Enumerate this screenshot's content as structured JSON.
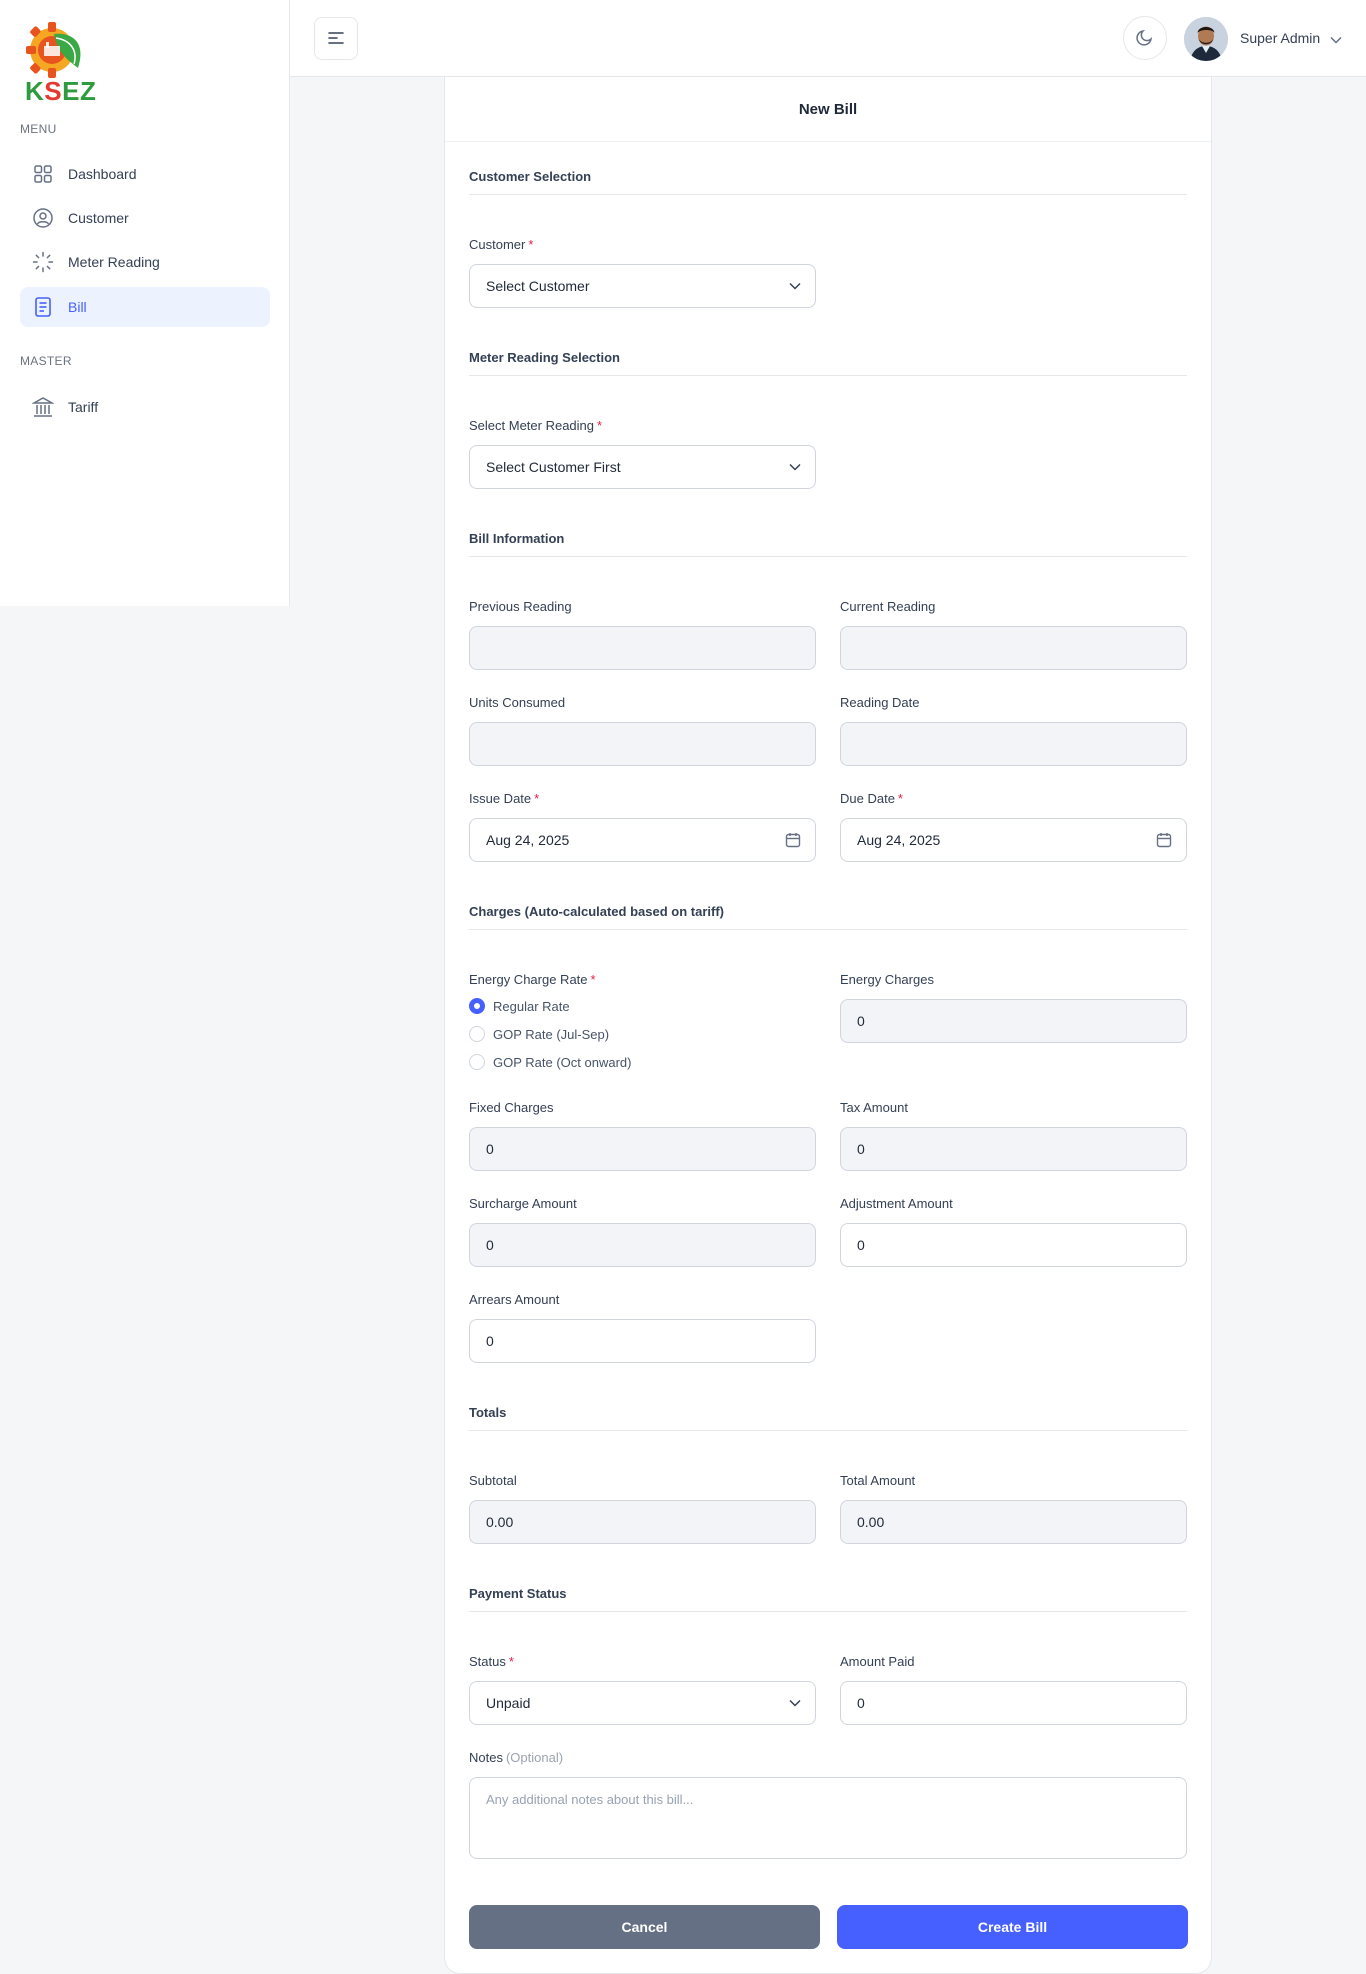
{
  "app": {
    "logo_text_k": "K",
    "logo_text_s": "S",
    "logo_text_rest": "EZ"
  },
  "sidebar": {
    "menu_heading": "MENU",
    "master_heading": "MASTER",
    "items": [
      {
        "label": "Dashboard",
        "icon": "grid-icon"
      },
      {
        "label": "Customer",
        "icon": "user-circle-icon"
      },
      {
        "label": "Meter Reading",
        "icon": "loader-icon"
      },
      {
        "label": "Bill",
        "icon": "document-icon",
        "active": true
      },
      {
        "label": "Tariff",
        "icon": "bank-icon"
      }
    ]
  },
  "header": {
    "user_name": "Super Admin"
  },
  "form": {
    "title": "New Bill",
    "sections": {
      "customer": "Customer Selection",
      "meter": "Meter Reading Selection",
      "bill_info": "Bill Information",
      "charges": "Charges (Auto-calculated based on tariff)",
      "totals": "Totals",
      "payment": "Payment Status"
    },
    "customer_label": "Customer",
    "customer_value": "Select Customer",
    "meter_label": "Select Meter Reading",
    "meter_value": "Select Customer First",
    "previous_reading_label": "Previous Reading",
    "current_reading_label": "Current Reading",
    "units_consumed_label": "Units Consumed",
    "reading_date_label": "Reading Date",
    "issue_date_label": "Issue Date",
    "issue_date_value": "Aug 24, 2025",
    "due_date_label": "Due Date",
    "due_date_value": "Aug 24, 2025",
    "energy_rate_label": "Energy Charge Rate",
    "rate_options": [
      "Regular Rate",
      "GOP Rate (Jul-Sep)",
      "GOP Rate (Oct onward)"
    ],
    "selected_rate": "Regular Rate",
    "energy_charges_label": "Energy Charges",
    "energy_charges_value": "0",
    "fixed_charges_label": "Fixed Charges",
    "fixed_charges_value": "0",
    "tax_amount_label": "Tax Amount",
    "tax_amount_value": "0",
    "surcharge_label": "Surcharge Amount",
    "surcharge_value": "0",
    "adjustment_label": "Adjustment Amount",
    "adjustment_value": "0",
    "arrears_label": "Arrears Amount",
    "arrears_value": "0",
    "subtotal_label": "Subtotal",
    "subtotal_value": "0.00",
    "total_label": "Total Amount",
    "total_value": "0.00",
    "status_label": "Status",
    "status_value": "Unpaid",
    "amount_paid_label": "Amount Paid",
    "amount_paid_value": "0",
    "notes_label": "Notes",
    "notes_optional": "(Optional)",
    "notes_placeholder": "Any additional notes about this bill...",
    "cancel_label": "Cancel",
    "create_label": "Create Bill",
    "required_mark": "*"
  },
  "colors": {
    "accent": "#465fff",
    "cancel": "#667085",
    "required": "#e11d48",
    "active_bg": "#ecf3ff"
  }
}
